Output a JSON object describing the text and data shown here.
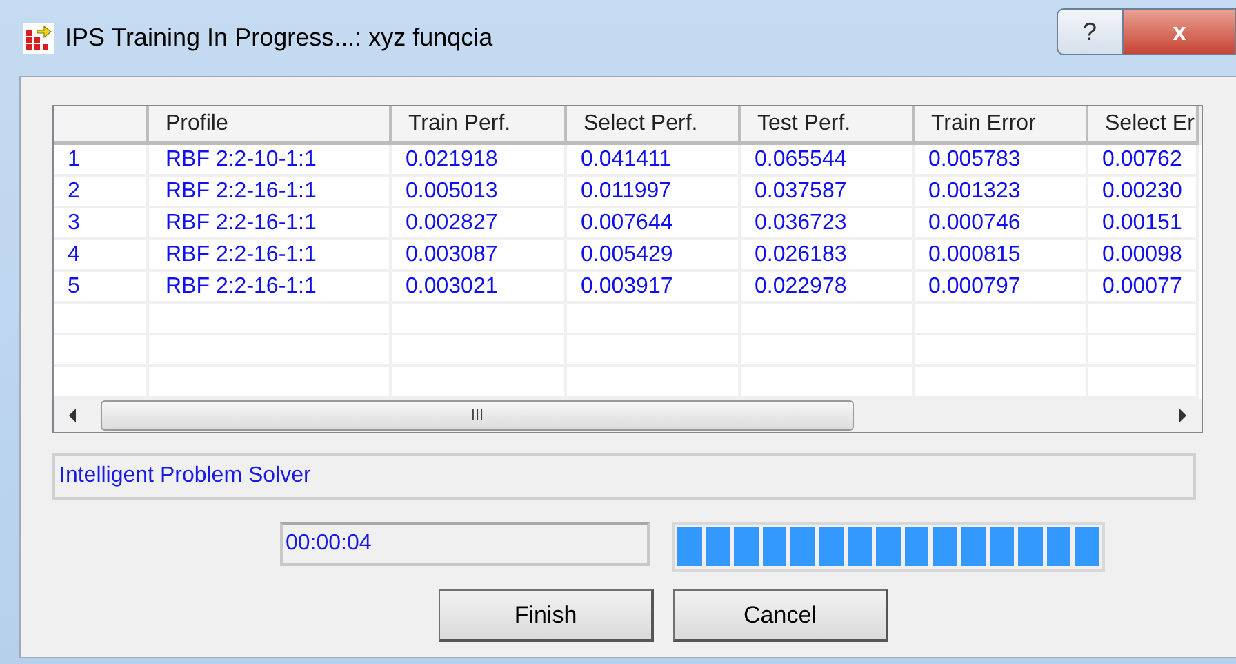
{
  "window": {
    "title": "IPS Training In Progress...: xyz funqcia",
    "help_button": "?",
    "close_button": "x"
  },
  "table": {
    "columns": [
      "",
      "Profile",
      "Train Perf.",
      "Select Perf.",
      "Test Perf.",
      "Train Error",
      "Select Er"
    ],
    "rows": [
      [
        "1",
        "RBF 2:2-10-1:1",
        "0.021918",
        "0.041411",
        "0.065544",
        "0.005783",
        "0.00762"
      ],
      [
        "2",
        "RBF 2:2-16-1:1",
        "0.005013",
        "0.011997",
        "0.037587",
        "0.001323",
        "0.00230"
      ],
      [
        "3",
        "RBF 2:2-16-1:1",
        "0.002827",
        "0.007644",
        "0.036723",
        "0.000746",
        "0.00151"
      ],
      [
        "4",
        "RBF 2:2-16-1:1",
        "0.003087",
        "0.005429",
        "0.026183",
        "0.000815",
        "0.00098"
      ],
      [
        "5",
        "RBF 2:2-16-1:1",
        "0.003021",
        "0.003917",
        "0.022978",
        "0.000797",
        "0.00077"
      ]
    ],
    "scroll_thumb": "III"
  },
  "status": "Intelligent Problem Solver",
  "elapsed": "00:00:04",
  "progress": {
    "level": 1
  },
  "buttons": [
    "Finish",
    "Cancel"
  ]
}
